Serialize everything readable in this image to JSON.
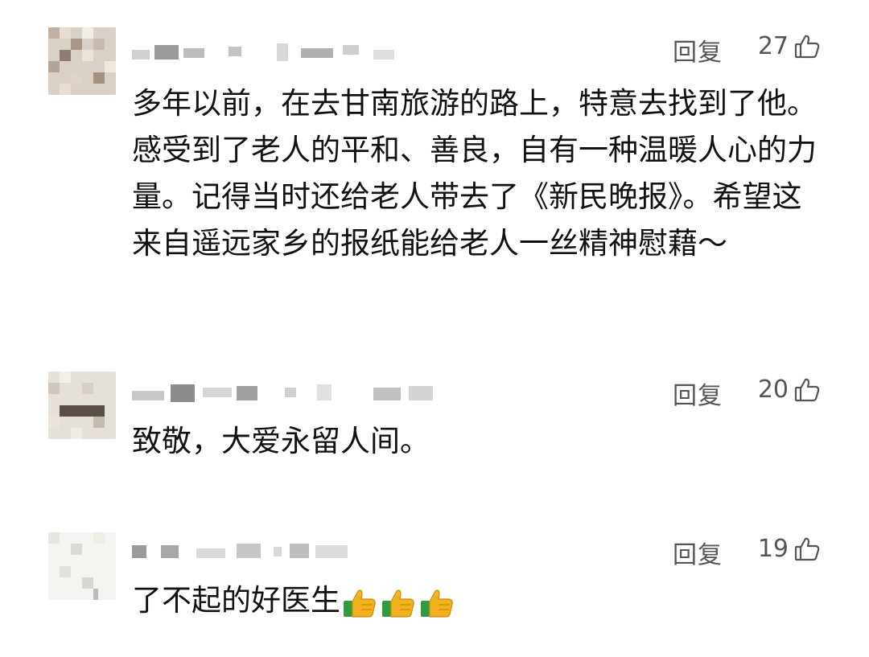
{
  "comments": [
    {
      "reply_label": "回复",
      "likes": "27",
      "text": "多年以前，在去甘南旅游的路上，特意去找到了他。感受到了老人的平和、善良，自有一种温暖人心的力量。记得当时还给老人带去了《新民晚报》。希望这来自遥远家乡的报纸能给老人一丝精神慰藉～"
    },
    {
      "reply_label": "回复",
      "likes": "20",
      "text": "致敬，大爱永留人间。"
    },
    {
      "reply_label": "回复",
      "likes": "19",
      "text": "了不起的好医生",
      "emojis": [
        "thumbs-up",
        "thumbs-up",
        "thumbs-up"
      ]
    }
  ],
  "icons": {
    "like": "thumbs-up-outline-icon",
    "emoji": "thumbs-up-emoji"
  },
  "colors": {
    "text": "#111111",
    "meta": "#555555",
    "background": "#ffffff",
    "emoji_cuff": "#2e9e3c",
    "emoji_hand": "#f2b21c"
  }
}
